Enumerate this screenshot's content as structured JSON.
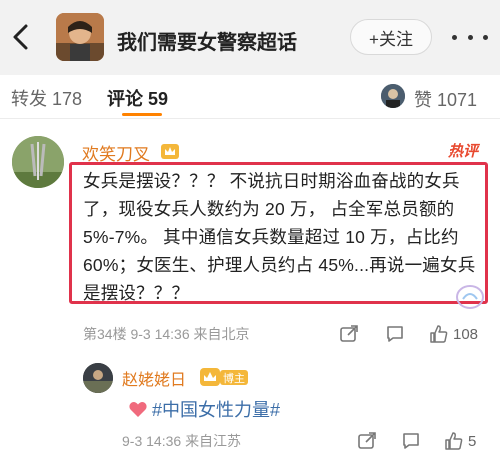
{
  "header": {
    "title": "我们需要女警察超话",
    "follow_label": "+关注"
  },
  "tabs": {
    "repost_label": "转发",
    "repost_count": "178",
    "comment_label": "评论",
    "comment_count": "59",
    "like_label": "赞",
    "like_count": "1071"
  },
  "comment": {
    "user": "欢笑刀叉",
    "hot_label": "热评",
    "text": "女兵是摆设？？？ 不说抗日时期浴血奋战的女兵了，现役女兵人数约为 20 万， 占全军总员额的 5%-7%。 其中通信女兵数量超过 10 万，占比约 60%；女医生、护理人员约占 45%...再说一遍女兵是摆设？？？",
    "floor": "第34楼",
    "time": "9-3 14:36",
    "location": "来自北京",
    "like_count": "108"
  },
  "reply": {
    "user": "赵姥姥日",
    "badge": "博主",
    "topic": "#中国女性力量#",
    "time": "9-3 14:36",
    "location": "来自江苏",
    "like_count": "5"
  },
  "icons": {
    "back": "chevron-left-icon",
    "more": "more-dots-icon",
    "share": "share-icon",
    "comment": "comment-icon",
    "like": "thumbs-up-icon",
    "heart": "heart-icon"
  },
  "colors": {
    "username": "#e07a1f",
    "hot": "#e8492f",
    "highlight_box": "#e0324b",
    "tab_underline": "#ff8200",
    "topic": "#3c6ea8"
  }
}
